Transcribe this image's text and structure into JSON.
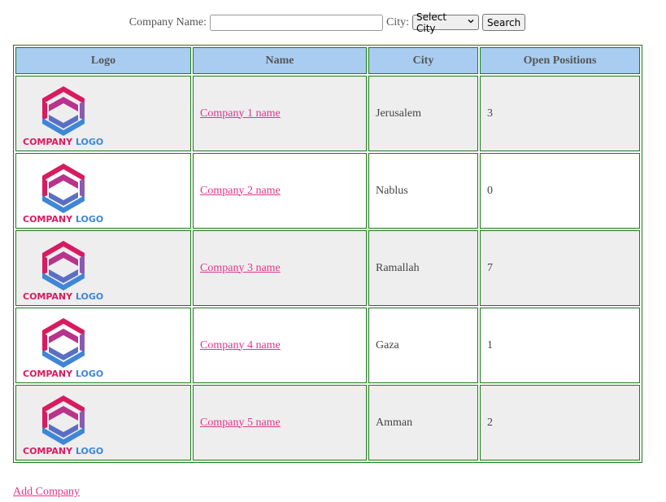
{
  "filter": {
    "company_label": "Company Name:",
    "company_value": "",
    "city_label": "City:",
    "city_selected": "Select City",
    "search_label": "Search"
  },
  "table": {
    "headers": [
      "Logo",
      "Name",
      "City",
      "Open Positions"
    ],
    "rows": [
      {
        "logo_text": "COMPANY LOGO",
        "name": "Company 1 name",
        "city": "Jerusalem",
        "open": "3"
      },
      {
        "logo_text": "COMPANY LOGO",
        "name": "Company 2 name",
        "city": "Nablus",
        "open": "0"
      },
      {
        "logo_text": "COMPANY LOGO",
        "name": "Company 3 name",
        "city": "Ramallah",
        "open": "7"
      },
      {
        "logo_text": "COMPANY LOGO",
        "name": "Company 4 name",
        "city": "Gaza",
        "open": "1"
      },
      {
        "logo_text": "COMPANY LOGO",
        "name": "Company 5 name",
        "city": "Amman",
        "open": "2"
      }
    ]
  },
  "footer": {
    "add_label": "Add Company"
  },
  "colors": {
    "header_bg": "#a9cdf0",
    "border": "#1a7a1a",
    "link": "#e0368c",
    "logo_pink": "#d81b60",
    "logo_blue": "#3f86d6"
  }
}
